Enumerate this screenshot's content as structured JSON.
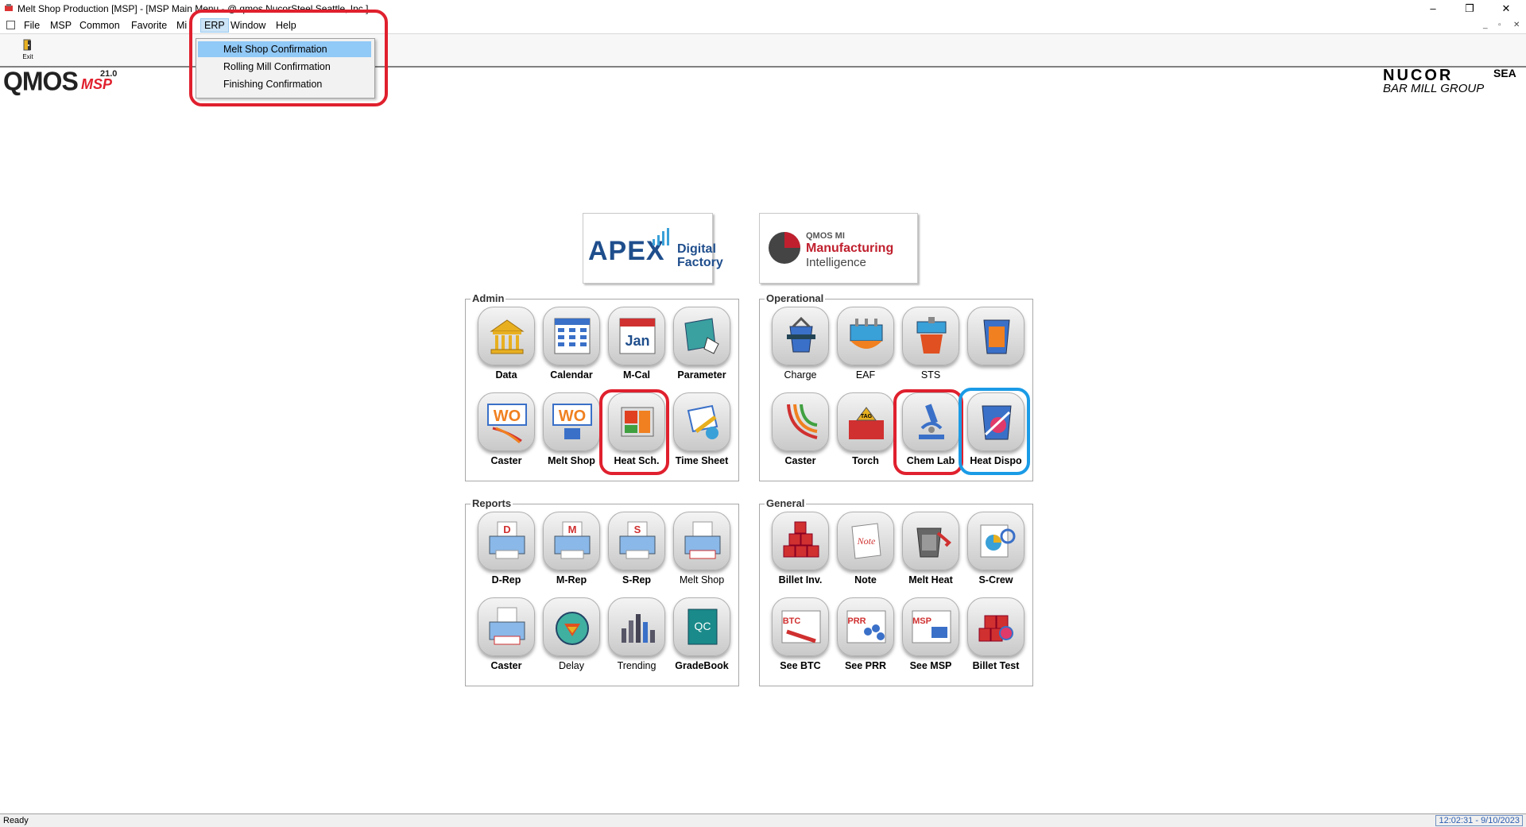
{
  "window": {
    "title": "Melt Shop Production [MSP] - [MSP Main Menu - @ qmos NucorSteel Seattle, Inc.]",
    "controls": [
      "–",
      "❐",
      "✕"
    ]
  },
  "menubar": {
    "items": [
      "File",
      "MSP",
      "Common",
      "Favorite",
      "Mi",
      "ERP",
      "Window",
      "Help"
    ],
    "mdi_controls": [
      "_",
      "▫",
      "✕"
    ]
  },
  "toolbar": {
    "exit_label": "Exit"
  },
  "erp_menu": {
    "items": [
      "Melt Shop Confirmation",
      "Rolling Mill Confirmation",
      "Finishing Confirmation"
    ]
  },
  "logo": {
    "qmos": "QMOS",
    "msp": "MSP",
    "version": "21.0"
  },
  "nucor": {
    "name": "NUCOR",
    "sea": "SEA",
    "sub": "BAR MILL  GROUP"
  },
  "brands": {
    "apex": {
      "main": "APEX",
      "line1": "Digital",
      "line2": "Factory"
    },
    "qmos_mi": {
      "small": "QMOS MI",
      "line1": "Manufacturing",
      "line2": "Intelligence"
    }
  },
  "groups": {
    "admin": {
      "title": "Admin",
      "tiles": [
        "Data",
        "Calendar",
        "M-Cal",
        "Parameter",
        "Caster",
        "Melt Shop",
        "Heat Sch.",
        "Time Sheet"
      ]
    },
    "operational": {
      "title": "Operational",
      "tiles": [
        "Charge",
        "EAF",
        "STS",
        "",
        "Caster",
        "Torch",
        "Chem Lab",
        "Heat Dispo"
      ]
    },
    "reports": {
      "title": "Reports",
      "tiles": [
        "D-Rep",
        "M-Rep",
        "S-Rep",
        "Melt Shop",
        "Caster",
        "Delay",
        "Trending",
        "GradeBook"
      ]
    },
    "general": {
      "title": "General",
      "tiles": [
        "Billet Inv.",
        "Note",
        "Melt Heat",
        "S-Crew",
        "See BTC",
        "See PRR",
        "See MSP",
        "Billet Test"
      ]
    }
  },
  "status": {
    "text": "Ready",
    "clock": "12:02:31 - 9/10/2023"
  }
}
